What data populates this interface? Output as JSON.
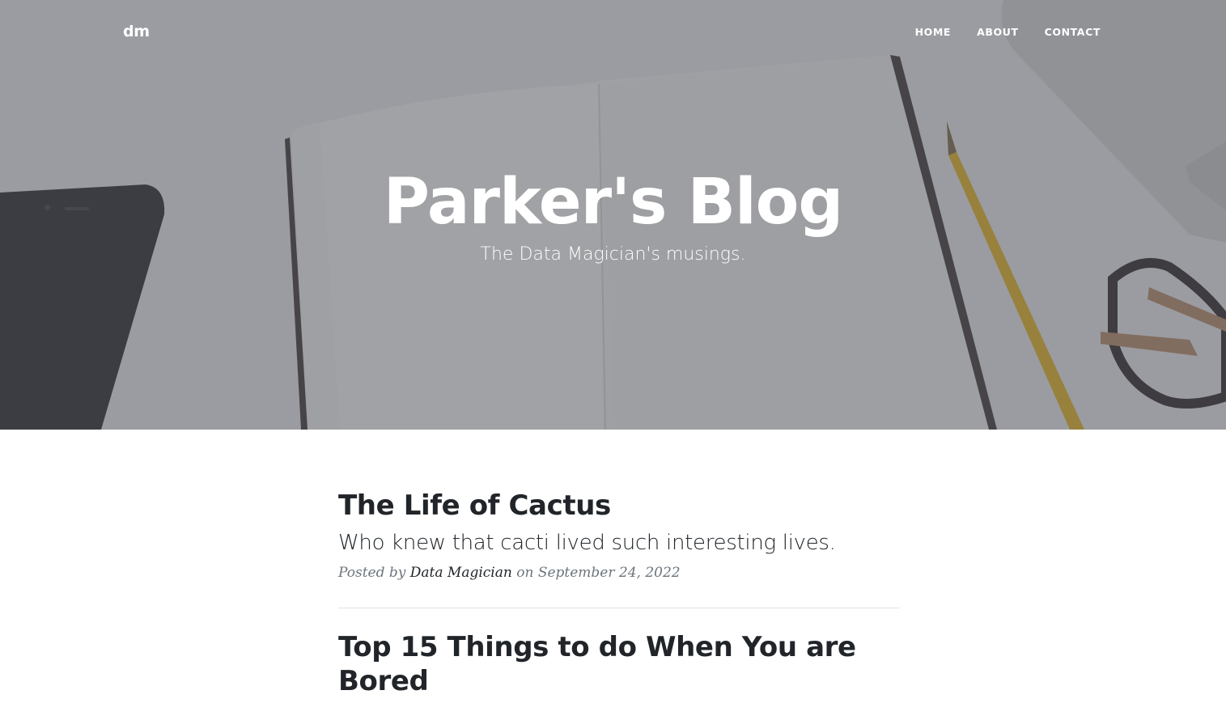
{
  "navbar": {
    "brand": "dm",
    "links": [
      "HOME",
      "ABOUT",
      "CONTACT"
    ]
  },
  "hero": {
    "title": "Parker's Blog",
    "subtitle": "The Data Magician's musings."
  },
  "posts": [
    {
      "title": "The Life of Cactus",
      "subtitle": "Who knew that cacti lived such interesting lives.",
      "meta_prefix": "Posted by",
      "author": "Data Magician",
      "meta_on": "on",
      "date": "September 24, 2022"
    },
    {
      "title": "Top 15 Things to do When You are Bored"
    }
  ]
}
